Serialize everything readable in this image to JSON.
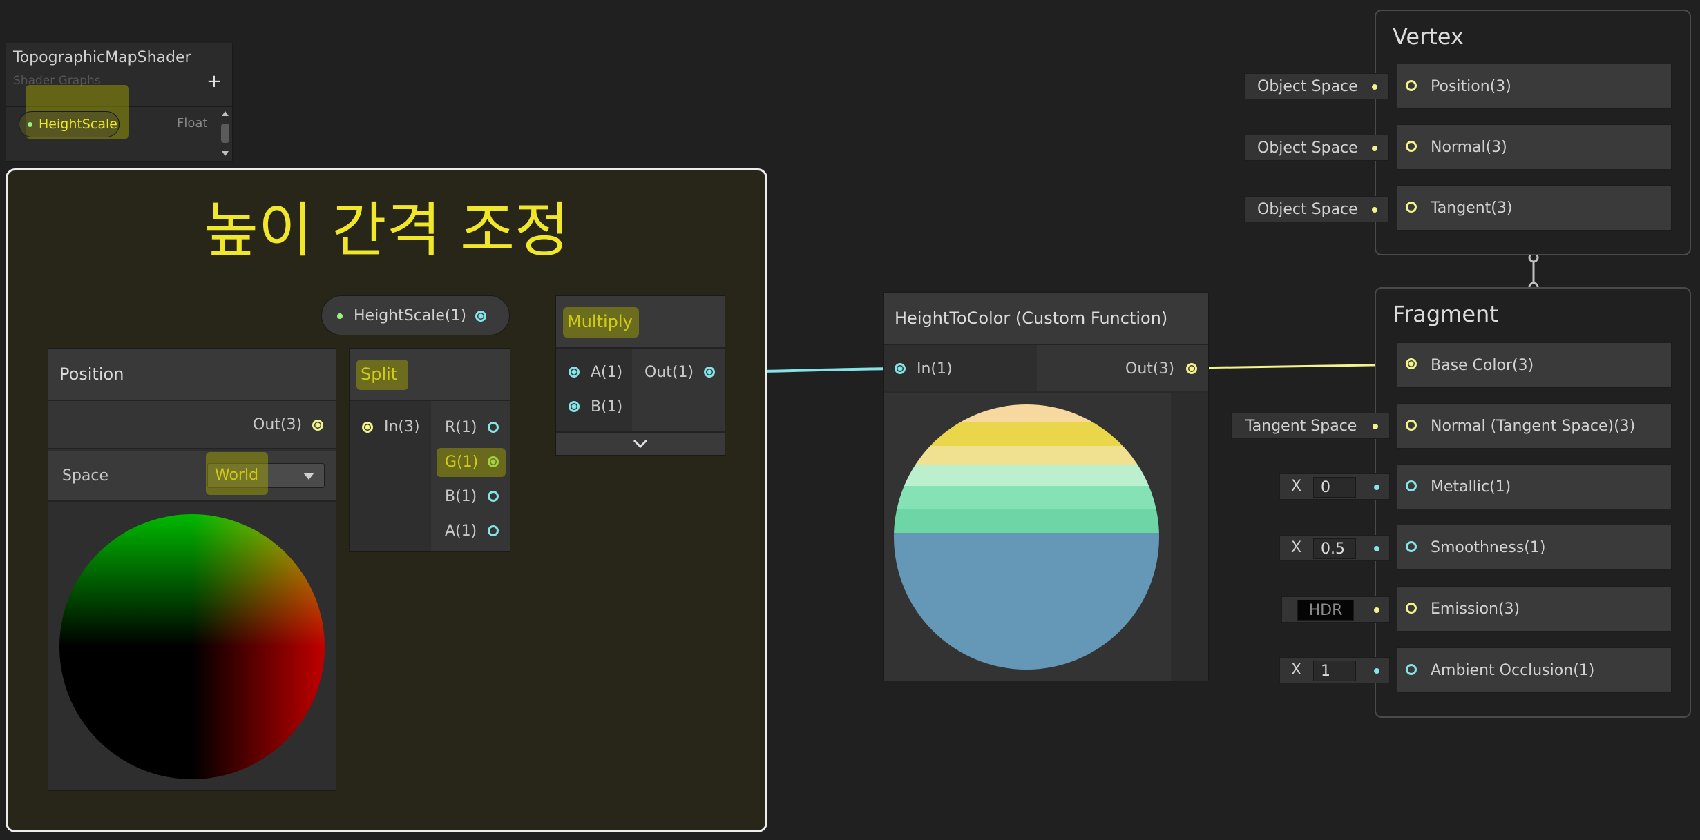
{
  "blackboard": {
    "title": "TopographicMapShader",
    "subtitle": "Shader Graphs",
    "add_label": "+",
    "property_name": "HeightScale",
    "property_type": "Float"
  },
  "group": {
    "title": "높이 간격 조정"
  },
  "property_node": {
    "label": "HeightScale(1)"
  },
  "position_node": {
    "title": "Position",
    "out_label": "Out(3)",
    "space_label": "Space",
    "space_value": "World"
  },
  "split_node": {
    "title": "Split",
    "in_label": "In(3)",
    "outputs": [
      "R(1)",
      "G(1)",
      "B(1)",
      "A(1)"
    ]
  },
  "multiply_node": {
    "title": "Multiply",
    "inputs": [
      "A(1)",
      "B(1)"
    ],
    "out_label": "Out(1)"
  },
  "custom_node": {
    "title": "HeightToColor (Custom Function)",
    "in_label": "In(1)",
    "out_label": "Out(3)"
  },
  "vertex": {
    "title": "Vertex",
    "slots": [
      {
        "label": "Position(3)",
        "chip": "Object Space"
      },
      {
        "label": "Normal(3)",
        "chip": "Object Space"
      },
      {
        "label": "Tangent(3)",
        "chip": "Object Space"
      }
    ]
  },
  "fragment": {
    "title": "Fragment",
    "slots": [
      {
        "label": "Base Color(3)"
      },
      {
        "label": "Normal (Tangent Space)(3)",
        "chip": "Tangent Space"
      },
      {
        "label": "Metallic(1)",
        "axis": "X",
        "value": "0"
      },
      {
        "label": "Smoothness(1)",
        "axis": "X",
        "value": "0.5"
      },
      {
        "label": "Emission(3)",
        "chip": "HDR"
      },
      {
        "label": "Ambient Occlusion(1)",
        "axis": "X",
        "value": "1"
      }
    ]
  },
  "colors": {
    "background": "#202020",
    "group_fill": "#272619",
    "group_title": "#f0e62a",
    "vector1_port": "#84e4e7",
    "vector3_port": "#f3f38b",
    "float_property": "#9cf27e",
    "highlight": "#8c8c00"
  }
}
